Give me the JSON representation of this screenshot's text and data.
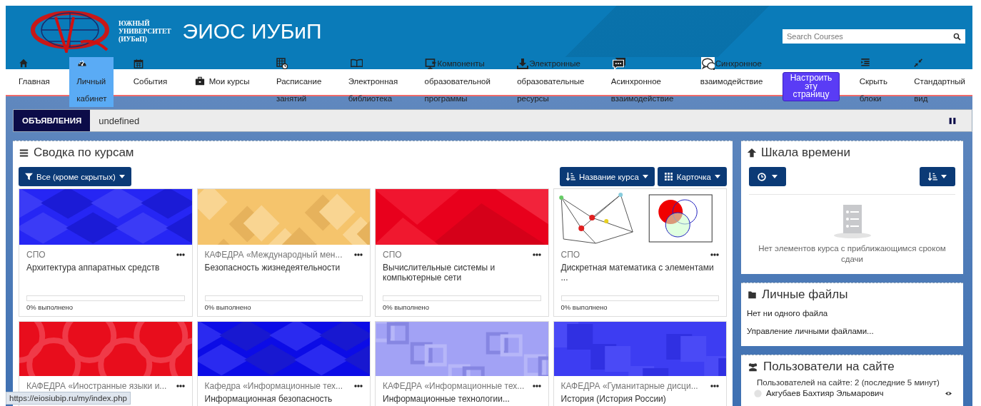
{
  "header": {
    "logo_caption": "ЮЖНЫЙ УНИВЕРСИТЕТ (ИУБиП)",
    "site_title": "ЭИОС ИУБиП",
    "search": {
      "placeholder": "Search Courses"
    }
  },
  "nav": [
    {
      "kind": "link",
      "label": "Главная",
      "selected": false
    },
    {
      "kind": "link",
      "label": "Личный кабинет",
      "selected": true
    },
    {
      "kind": "link",
      "label": "События",
      "selected": false
    },
    {
      "kind": "inline",
      "label": "Мои курсы",
      "selected": false
    },
    {
      "kind": "link",
      "label": "Расписание занятий",
      "selected": false
    },
    {
      "kind": "link",
      "label": "Электронная библиотека",
      "selected": false
    },
    {
      "kind": "link",
      "head": "Компоненты",
      "label": "образовательной программы",
      "selected": false
    },
    {
      "kind": "link",
      "head": "Электронные",
      "label": "образовательные ресурсы",
      "selected": false
    },
    {
      "kind": "link",
      "label": "Асинхронное взаимодействие",
      "selected": false
    },
    {
      "kind": "link",
      "head": "Синхронное",
      "label": "взаимодействие",
      "selected": false
    },
    {
      "kind": "button",
      "label": "Настроить эту страницу"
    },
    {
      "kind": "link",
      "label": "Скрыть блоки",
      "selected": false
    },
    {
      "kind": "link",
      "label": "Стандартный вид",
      "selected": false
    }
  ],
  "announcements": {
    "label": "ОБЪЯВЛЕНИЯ",
    "text": "undefined"
  },
  "course_overview": {
    "title": "Сводка по курсам",
    "filter_button": "Все (кроме скрытых)",
    "sort_button": "Название курса",
    "view_button": "Карточка",
    "courses": [
      {
        "category": "СПО",
        "title": "Архитектура аппаратных средств",
        "progress_label": "0% выполнено",
        "level": 0
      },
      {
        "category": "КАФЕДРА «Международный мен...",
        "title": "Безопасность жизнедеятельности",
        "progress_label": "0% выполнено",
        "level": 0
      },
      {
        "category": "СПО",
        "title": "Вычислительные системы и компьютерные сети",
        "progress_label": "0% выполнено",
        "level": 0
      },
      {
        "category": "СПО",
        "title": "Дискретная математика с элементами ...",
        "progress_label": "0% выполнено",
        "level": 0
      },
      {
        "category": "КАФЕДРА «Иностранные языки и..."
      },
      {
        "category": "Кафедра «Информационные тех...",
        "title": "Информационная безопасность"
      },
      {
        "category": "КАФЕДРА «Информационные тех...",
        "title": "Информационные технологии..."
      },
      {
        "category": "КАФЕДРА «Гуманитарные дисци...",
        "title": "История (История России)"
      }
    ]
  },
  "timeline": {
    "title": "Шкала времени",
    "empty_text": "Нет элементов курса с приближающимся сроком сдачи"
  },
  "private_files": {
    "title": "Личные файлы",
    "empty_text": "Нет ни одного файла",
    "manage_link": "Управление личными файлами..."
  },
  "online_users": {
    "title": "Пользователи на сайте",
    "summary": "Пользователей на сайте: 2 (последние 5 минут)",
    "users": [
      {
        "name": "Акгубаев Бахтияр Эльмарович"
      }
    ]
  },
  "status_bar": {
    "url": "https://eiosiubip.ru/my/index.php"
  }
}
